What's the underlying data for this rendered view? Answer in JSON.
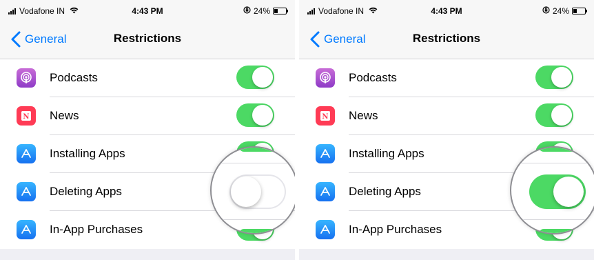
{
  "status_bar": {
    "carrier": "Vodafone IN",
    "time": "4:43 PM",
    "battery": "24%"
  },
  "nav": {
    "back_label": "General",
    "title": "Restrictions"
  },
  "colors": {
    "accent": "#007aff",
    "toggle_on": "#4cd964",
    "toggle_off_border": "#e5e5ea"
  },
  "panels": [
    {
      "rows": [
        {
          "label": "Podcasts",
          "icon": "podcasts-icon",
          "on": true
        },
        {
          "label": "News",
          "icon": "news-icon",
          "on": true
        },
        {
          "label": "Installing Apps",
          "icon": "app-store-icon",
          "on": true
        },
        {
          "label": "Deleting Apps",
          "icon": "app-store-icon",
          "on": false
        },
        {
          "label": "In-App Purchases",
          "icon": "app-store-icon",
          "on": true
        }
      ],
      "magnified_toggle": {
        "label": "Deleting Apps",
        "on": false
      }
    },
    {
      "rows": [
        {
          "label": "Podcasts",
          "icon": "podcasts-icon",
          "on": true
        },
        {
          "label": "News",
          "icon": "news-icon",
          "on": true
        },
        {
          "label": "Installing Apps",
          "icon": "app-store-icon",
          "on": true
        },
        {
          "label": "Deleting Apps",
          "icon": "app-store-icon",
          "on": true
        },
        {
          "label": "In-App Purchases",
          "icon": "app-store-icon",
          "on": true
        }
      ],
      "magnified_toggle": {
        "label": "Deleting Apps",
        "on": true
      }
    }
  ]
}
